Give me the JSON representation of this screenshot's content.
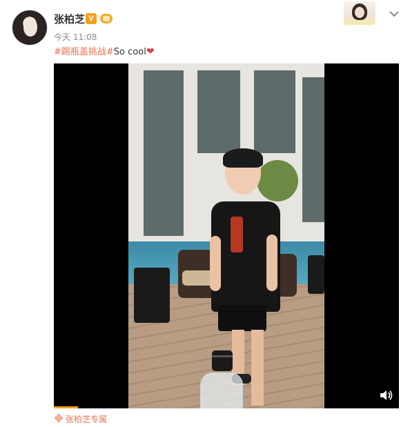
{
  "post": {
    "author_name": "张柏芝",
    "verified_mark": "V",
    "time": "今天 11:08",
    "hashtag": "#踢瓶盖挑战#",
    "text": "So cool",
    "emoji": "❤"
  },
  "source": {
    "name": "张柏芝专属"
  },
  "video": {
    "progress_percent": 7,
    "muted": false
  },
  "icons": {
    "verify": "verified-v-icon",
    "member": "member-crown-icon",
    "menu": "chevron-down-icon",
    "volume": "volume-icon",
    "source": "flower-icon"
  },
  "colors": {
    "hashtag": "#eb7350",
    "verify_badge": "#f4a11b",
    "progress": "#f9a21a"
  }
}
